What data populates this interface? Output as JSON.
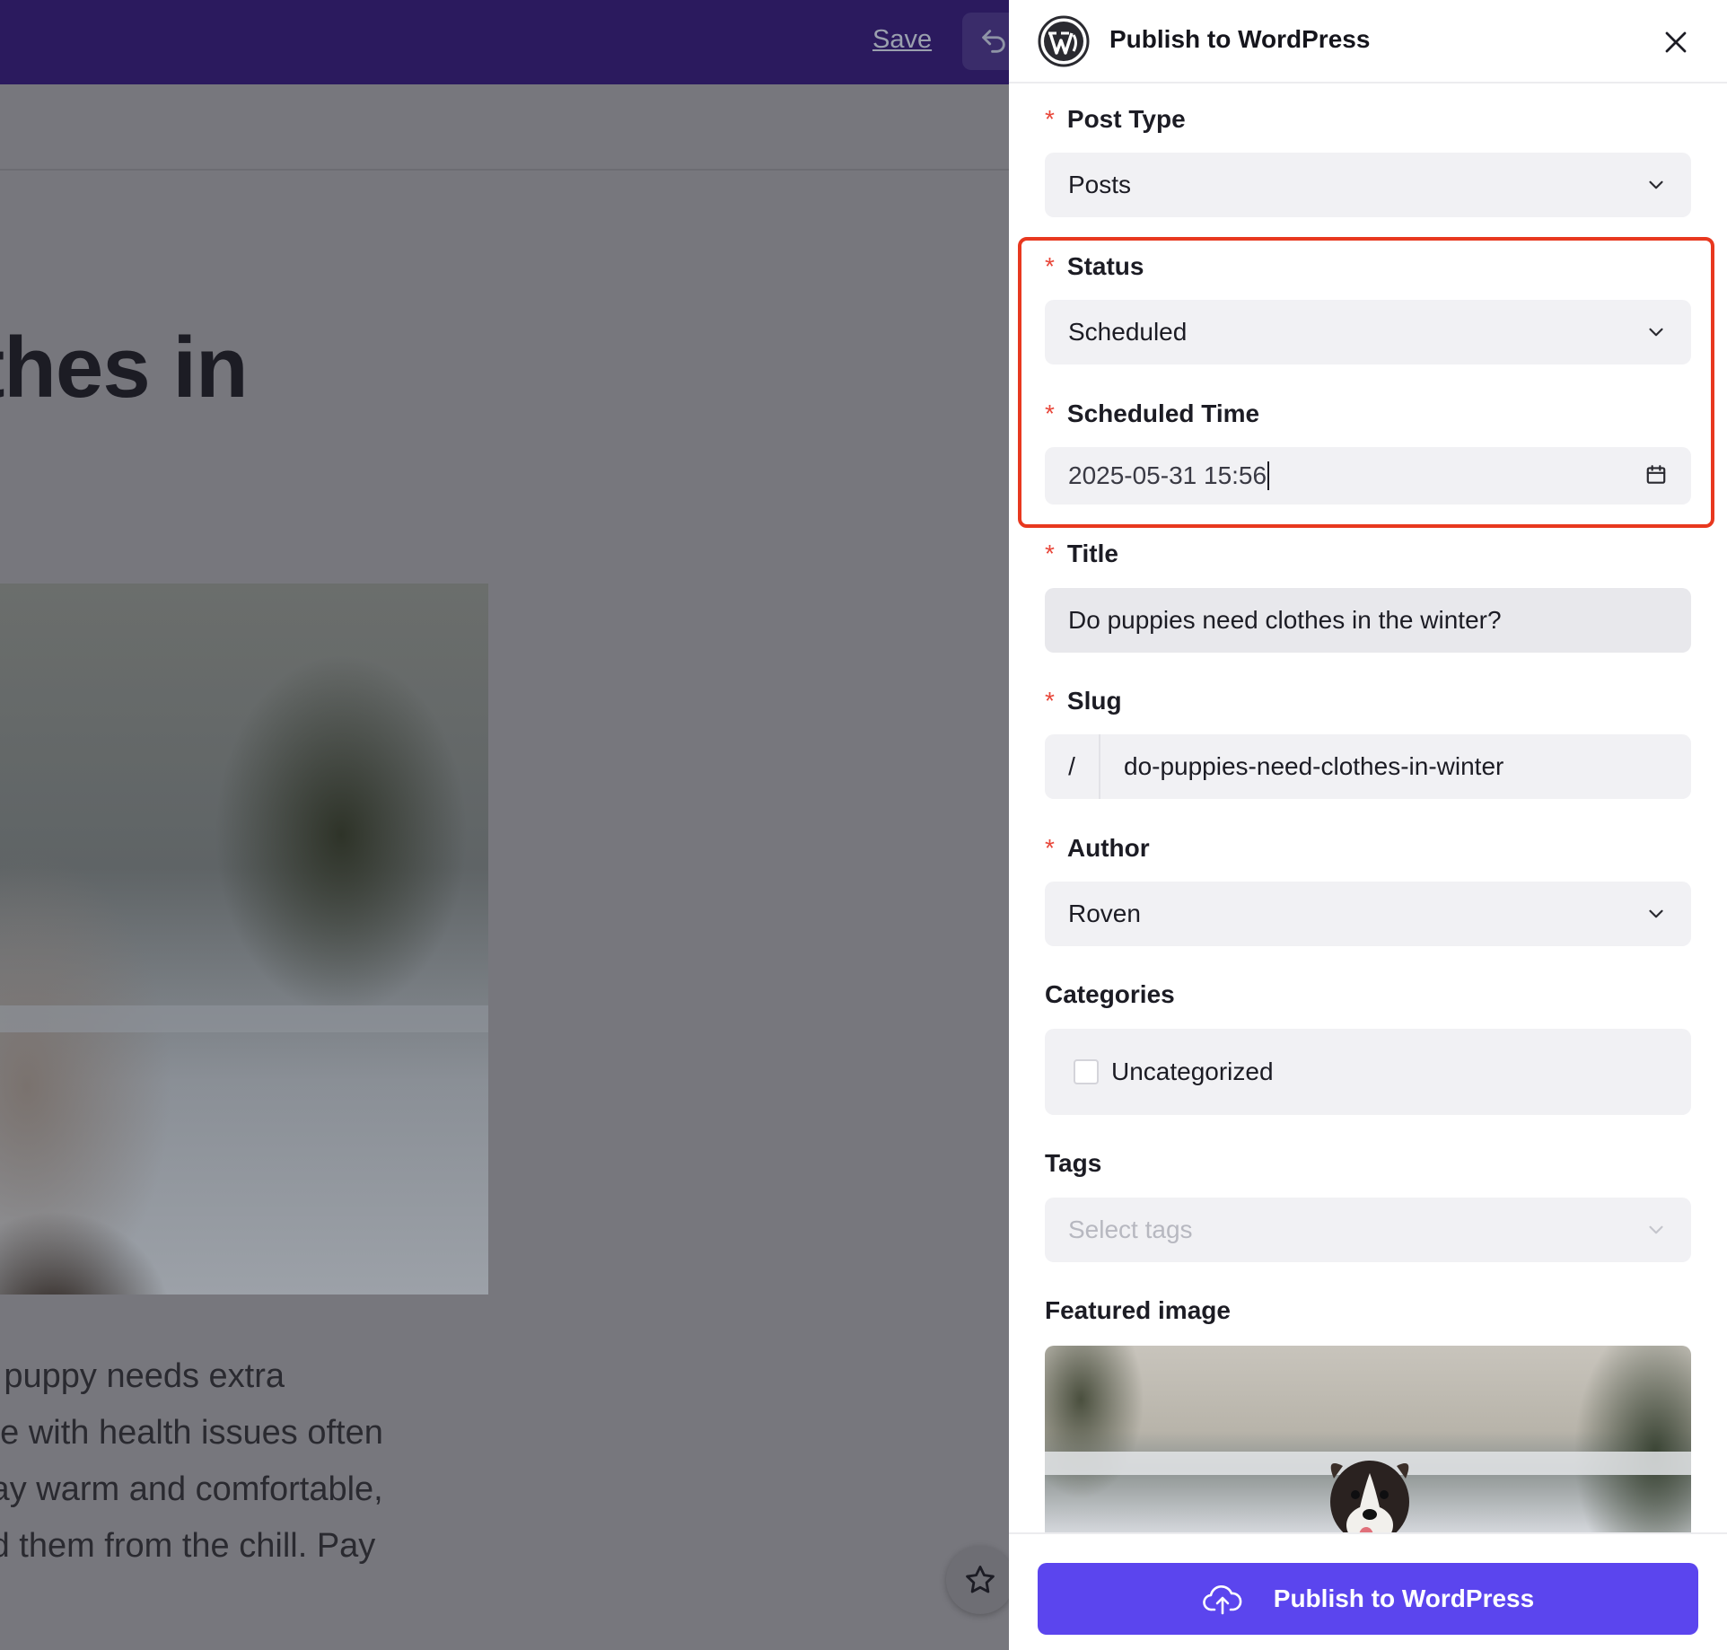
{
  "editor": {
    "save_label": "Save",
    "article_title_fragment": "lothes in",
    "article_text_lines": [
      "ur puppy needs extra",
      "ose with health issues often",
      "stay warm and comfortable,",
      "eld them from the chill. Pay"
    ]
  },
  "drawer": {
    "title": "Publish to WordPress",
    "fields": {
      "post_type": {
        "label": "Post Type",
        "value": "Posts"
      },
      "status": {
        "label": "Status",
        "value": "Scheduled"
      },
      "scheduled_time": {
        "label": "Scheduled Time",
        "value": "2025-05-31 15:56"
      },
      "title": {
        "label": "Title",
        "value": "Do puppies need clothes in the winter?"
      },
      "slug": {
        "label": "Slug",
        "prefix": "/",
        "value": "do-puppies-need-clothes-in-winter"
      },
      "author": {
        "label": "Author",
        "value": "Roven"
      },
      "categories": {
        "label": "Categories",
        "options": [
          "Uncategorized"
        ]
      },
      "tags": {
        "label": "Tags",
        "placeholder": "Select tags"
      },
      "featured_image": {
        "label": "Featured image"
      }
    },
    "required_marker": "*",
    "publish_label": "Publish to WordPress"
  },
  "colors": {
    "accent": "#5b45ee",
    "required": "#e8473a",
    "highlight": "#e8381f",
    "editor_topbar": "#2b1a5e"
  },
  "icons": {
    "logo": "wordpress-logo-icon",
    "close": "close-icon",
    "dropdown": "chevron-down-icon",
    "date": "calendar-icon",
    "upload": "cloud-upload-icon",
    "undo": "undo-icon",
    "favorite": "star-icon"
  }
}
